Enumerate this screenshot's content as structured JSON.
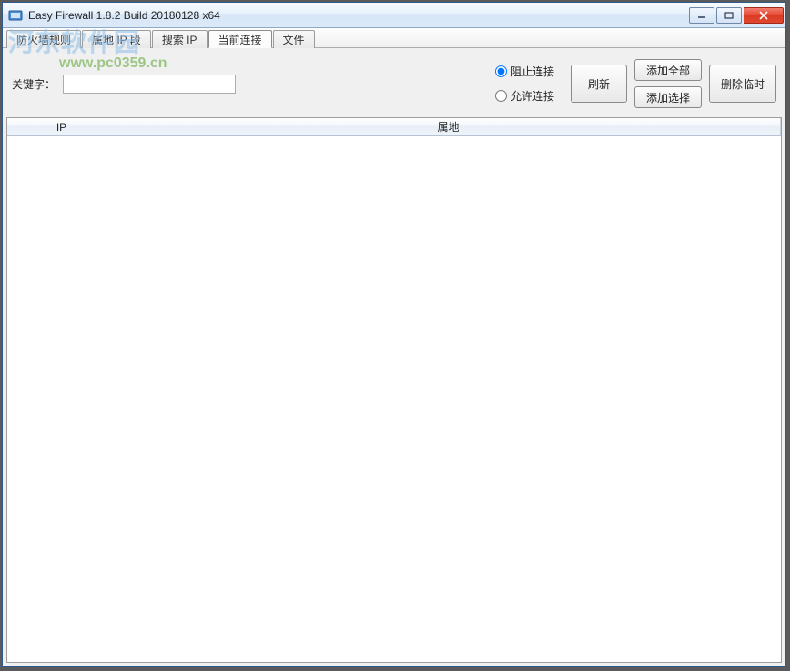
{
  "window": {
    "title": "Easy Firewall 1.8.2 Build 20180128 x64"
  },
  "tabs": [
    {
      "label": "防火墙规则"
    },
    {
      "label": "属地 IP 段"
    },
    {
      "label": "搜索 IP"
    },
    {
      "label": "当前连接"
    },
    {
      "label": "文件"
    }
  ],
  "active_tab_index": 3,
  "toolbar": {
    "keyword_label": "关键字：",
    "keyword_value": "",
    "radio_block": "阻止连接",
    "radio_allow": "允许连接",
    "radio_selected": "block",
    "refresh": "刷新",
    "add_all": "添加全部",
    "add_selected": "添加选择",
    "delete_temp": "删除临时"
  },
  "table": {
    "columns": {
      "ip": "IP",
      "location": "属地"
    },
    "rows": []
  },
  "watermark": {
    "line1": "河东软件园",
    "line2": "www.pc0359.cn"
  }
}
